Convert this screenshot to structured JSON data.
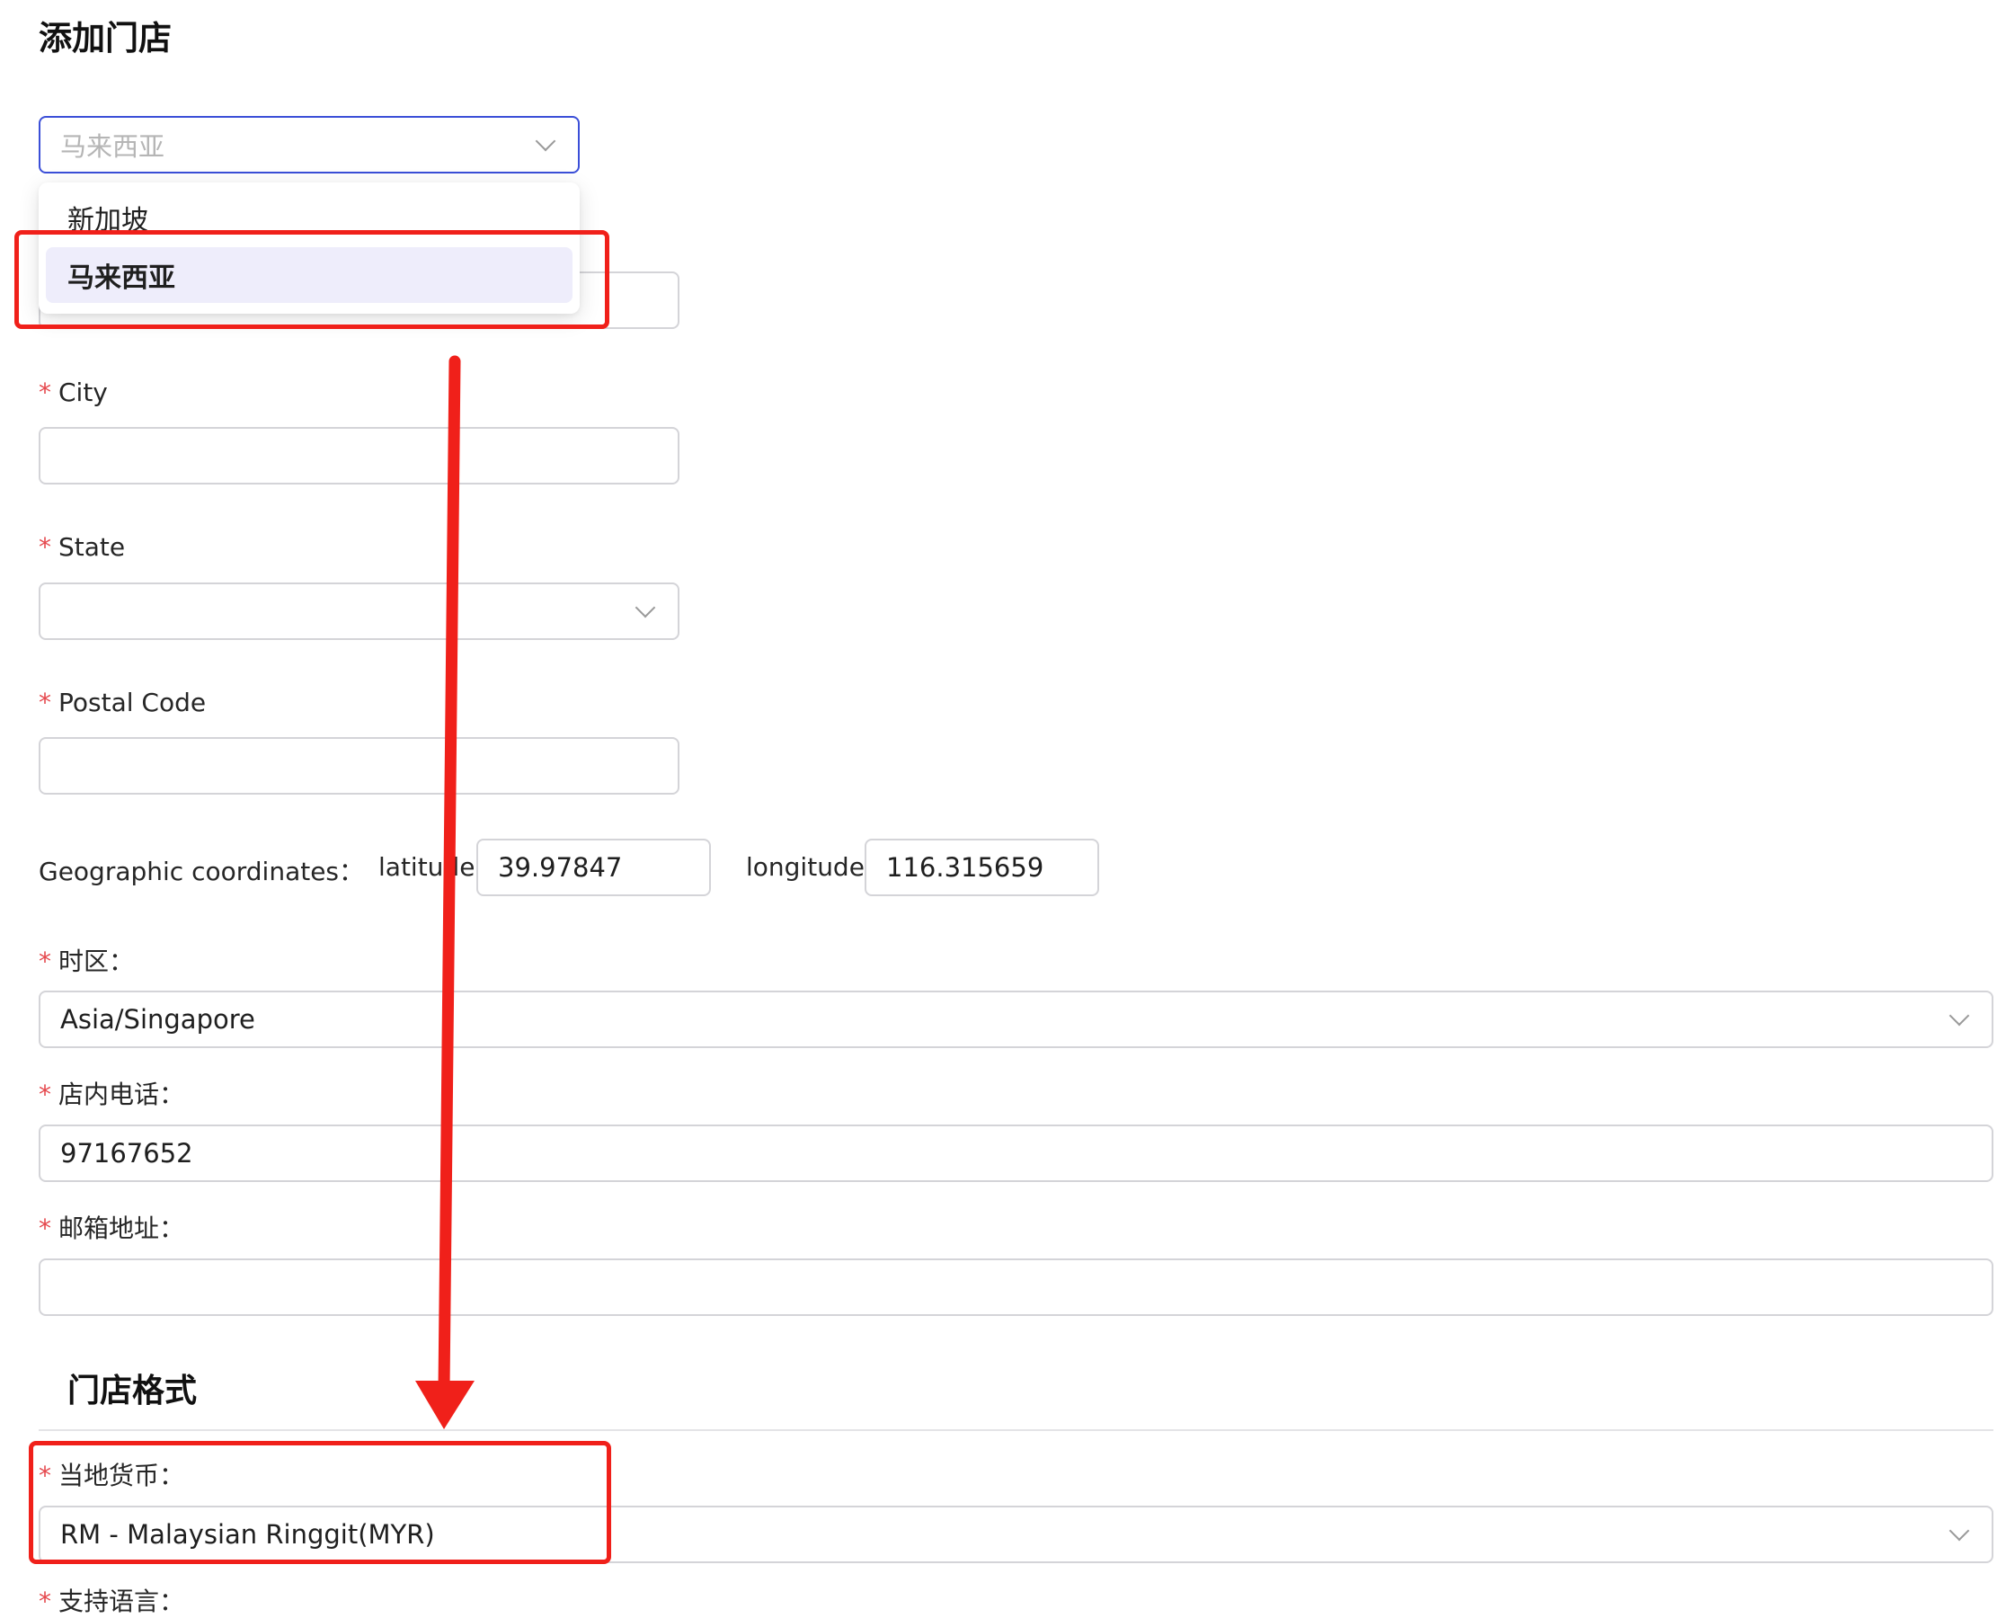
{
  "page": {
    "title": "添加门店"
  },
  "country_select": {
    "placeholder": "马来西亚",
    "options": [
      "新加坡",
      "马来西亚"
    ],
    "selected": "马来西亚"
  },
  "city": {
    "label": "City",
    "value": ""
  },
  "state": {
    "label": "State",
    "value": ""
  },
  "postal_code": {
    "label": "Postal Code",
    "value": ""
  },
  "geo": {
    "label": "Geographic coordinates：",
    "latitude_label": "latitude",
    "latitude_value": "39.97847",
    "longitude_label": "longitude",
    "longitude_value": "116.315659"
  },
  "timezone": {
    "label": "时区：",
    "value": "Asia/Singapore"
  },
  "phone": {
    "label": "店内电话：",
    "value": "97167652"
  },
  "email": {
    "label": "邮箱地址：",
    "value": ""
  },
  "store_format": {
    "title": "门店格式"
  },
  "currency": {
    "label": "当地货币：",
    "value": "RM - Malaysian Ringgit(MYR)"
  },
  "language": {
    "label": "支持语言："
  },
  "required_mark": "*",
  "colors": {
    "accent": "#3b4fd8",
    "required": "#e5484d",
    "annotation": "#f0201a",
    "selected_bg": "#eeedfb"
  },
  "icons": [
    "chevron-down-icon",
    "annotation-arrow"
  ]
}
